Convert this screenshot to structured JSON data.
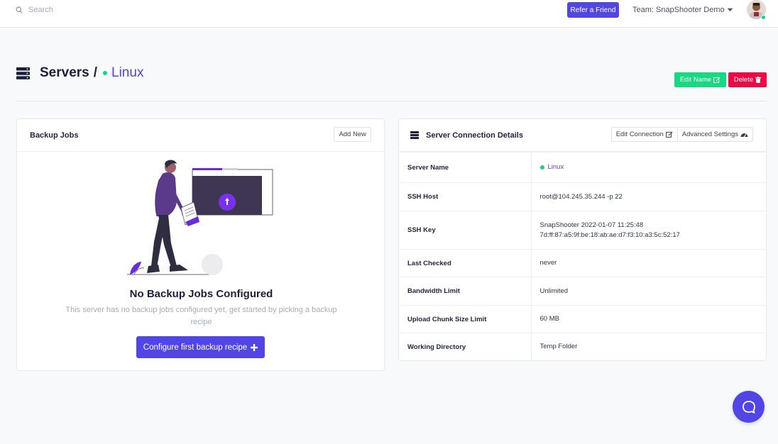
{
  "topbar": {
    "search_placeholder": "Search",
    "refer_label": "Refer a Friend",
    "team_label": "Team: SnapShooter Demo"
  },
  "header": {
    "title": "Servers",
    "separator": "/",
    "crumb": "Linux",
    "edit_name_label": "Edit Name",
    "delete_label": "Delete"
  },
  "backup_jobs": {
    "title": "Backup Jobs",
    "add_new_label": "Add New",
    "empty_title": "No Backup Jobs Configured",
    "empty_description": "This server has no backup jobs configured yet, get started by picking a backup recipe",
    "configure_label": "Configure first backup recipe"
  },
  "connection": {
    "title": "Server Connection Details",
    "edit_connection_label": "Edit Connection",
    "advanced_settings_label": "Advanced Settings",
    "rows": [
      {
        "key": "Server Name",
        "value": "Linux"
      },
      {
        "key": "SSH Host",
        "value": "root@104.245.35.244 -p 22"
      },
      {
        "key": "SSH Key",
        "value": "SnapShooter 2022-01-07 11:25:48",
        "value2": "7d:ff:87:a5:9f:be:18:ab:ae:d7:f3:10:a3:5c:52:17"
      },
      {
        "key": "Last Checked",
        "value": "never"
      },
      {
        "key": "Bandwidth Limit",
        "value": "Unlimited"
      },
      {
        "key": "Upload Chunk Size Limit",
        "value": "60 MB"
      },
      {
        "key": "Working Directory",
        "value": "Temp Folder"
      }
    ]
  },
  "colors": {
    "primary": "#5145e5",
    "success": "#17d982",
    "danger": "#ec0a45",
    "online": "#16d67c"
  },
  "icons": [
    "search-icon",
    "chevron-down-icon",
    "server-icon",
    "edit-icon",
    "trash-icon",
    "plus-icon",
    "gauge-icon",
    "chat-icon"
  ]
}
